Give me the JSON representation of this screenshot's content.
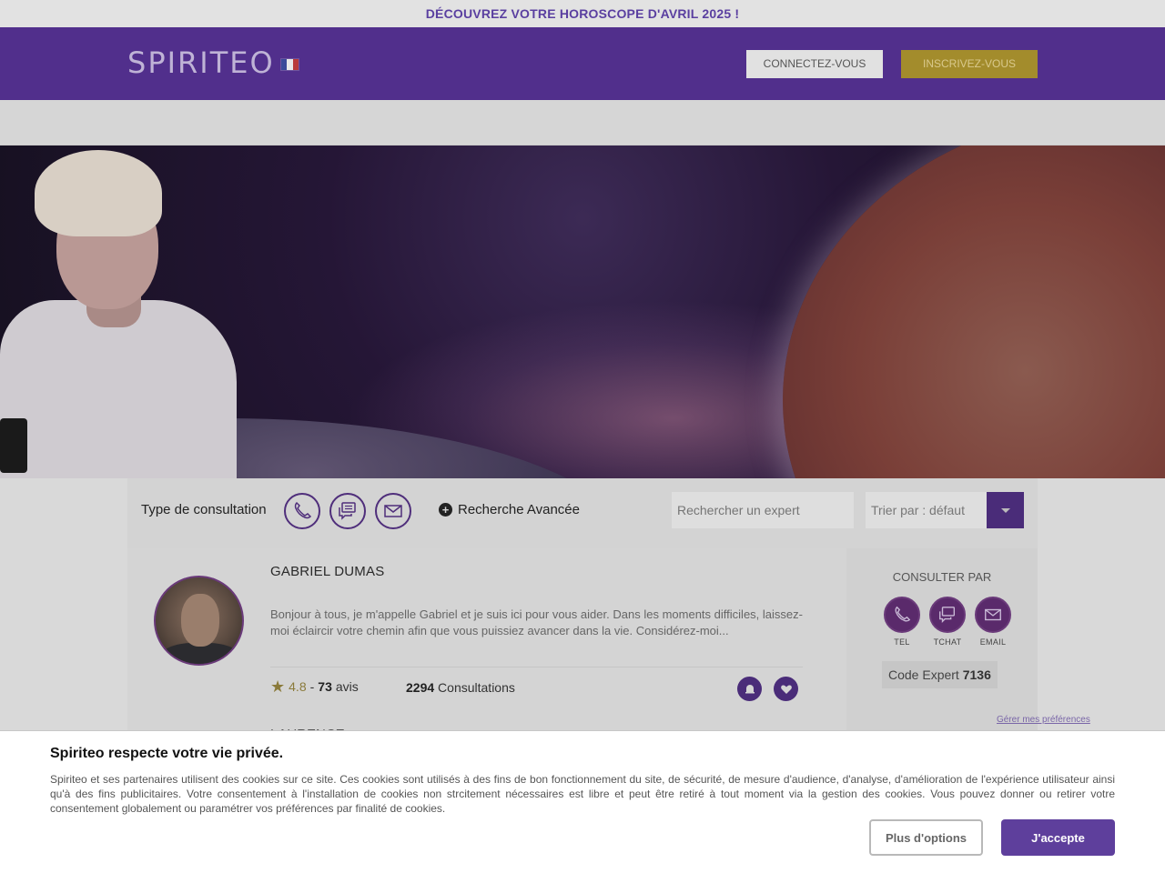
{
  "promo": {
    "text": "DÉCOUVREZ VOTRE HOROSCOPE D'AVRIL 2025 !"
  },
  "header": {
    "logo": "SPIRITEO",
    "connect_label": "CONNECTEZ-VOUS",
    "signup_label": "INSCRIVEZ-VOUS"
  },
  "filters": {
    "type_label": "Type de consultation",
    "advanced_label": "Recherche Avancée",
    "search_placeholder": "Rechercher un expert",
    "sort_label": "Trier par : défaut"
  },
  "expert": {
    "name": "GABRIEL DUMAS",
    "description": "Bonjour à tous, je m'appelle Gabriel et je suis ici pour vous aider. Dans les moments difficiles, laissez-moi éclaircir votre chemin afin que vous puissiez avancer dans la vie. Considérez-moi...",
    "rating": "4.8",
    "rating_sep": "-",
    "reviews_count": "73",
    "reviews_label": "avis",
    "consultations_count": "2294",
    "consultations_label": "Consultations",
    "consult_title": "CONSULTER PAR",
    "channels": {
      "tel": "TEL",
      "tchat": "TCHAT",
      "email": "EMAIL"
    },
    "code_label": "Code Expert",
    "code_value": "7136"
  },
  "next_expert": {
    "name": "LAURENCE"
  },
  "cookie": {
    "title": "Spiriteo respecte votre vie privée.",
    "text": "Spiriteo et ses partenaires utilisent des cookies sur ce site. Ces cookies sont utilisés à des fins de bon fonctionnement du site, de sécurité, de mesure d'audience, d'analyse, d'amélioration de l'expérience utilisateur ainsi qu'à des fins publicitaires. Votre consentement à l'installation de cookies non strcitement nécessaires est libre et peut être retiré à tout moment via la gestion des cookies. Vous pouvez donner ou retirer votre consentement globalement ou paramétrer vos préférences par finalité de cookies.",
    "pref_link": "Gérer mes préférences",
    "more_label": "Plus d'options",
    "accept_label": "J'accepte"
  },
  "colors": {
    "brand": "#512f8c",
    "accent": "#a38c2c",
    "accept": "#5e3f9c"
  },
  "icons": [
    "phone-icon",
    "chat-icon",
    "mail-icon",
    "plus-circle-icon",
    "caret-down-icon",
    "star-icon",
    "bell-icon",
    "heart-icon"
  ]
}
